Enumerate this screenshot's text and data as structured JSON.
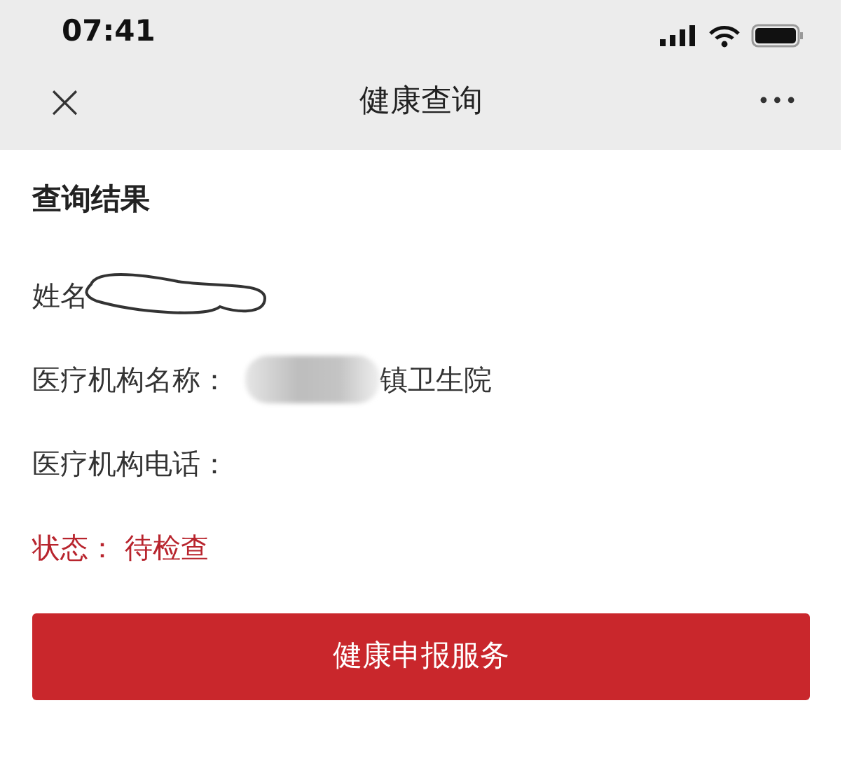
{
  "status_bar": {
    "time": "07:41"
  },
  "header": {
    "close": "×",
    "title": "健康查询",
    "more": "•••"
  },
  "result": {
    "heading": "查询结果",
    "rows": [
      {
        "kind": "scribbled",
        "label": "姓名"
      },
      {
        "kind": "blurred",
        "label": "医疗机构名称：",
        "value": "镇卫生院"
      },
      {
        "kind": "plain",
        "label": "医疗机构电话："
      },
      {
        "kind": "status",
        "label": "状态：",
        "value": "待检查"
      }
    ]
  },
  "button": {
    "label": "健康申报服务"
  }
}
